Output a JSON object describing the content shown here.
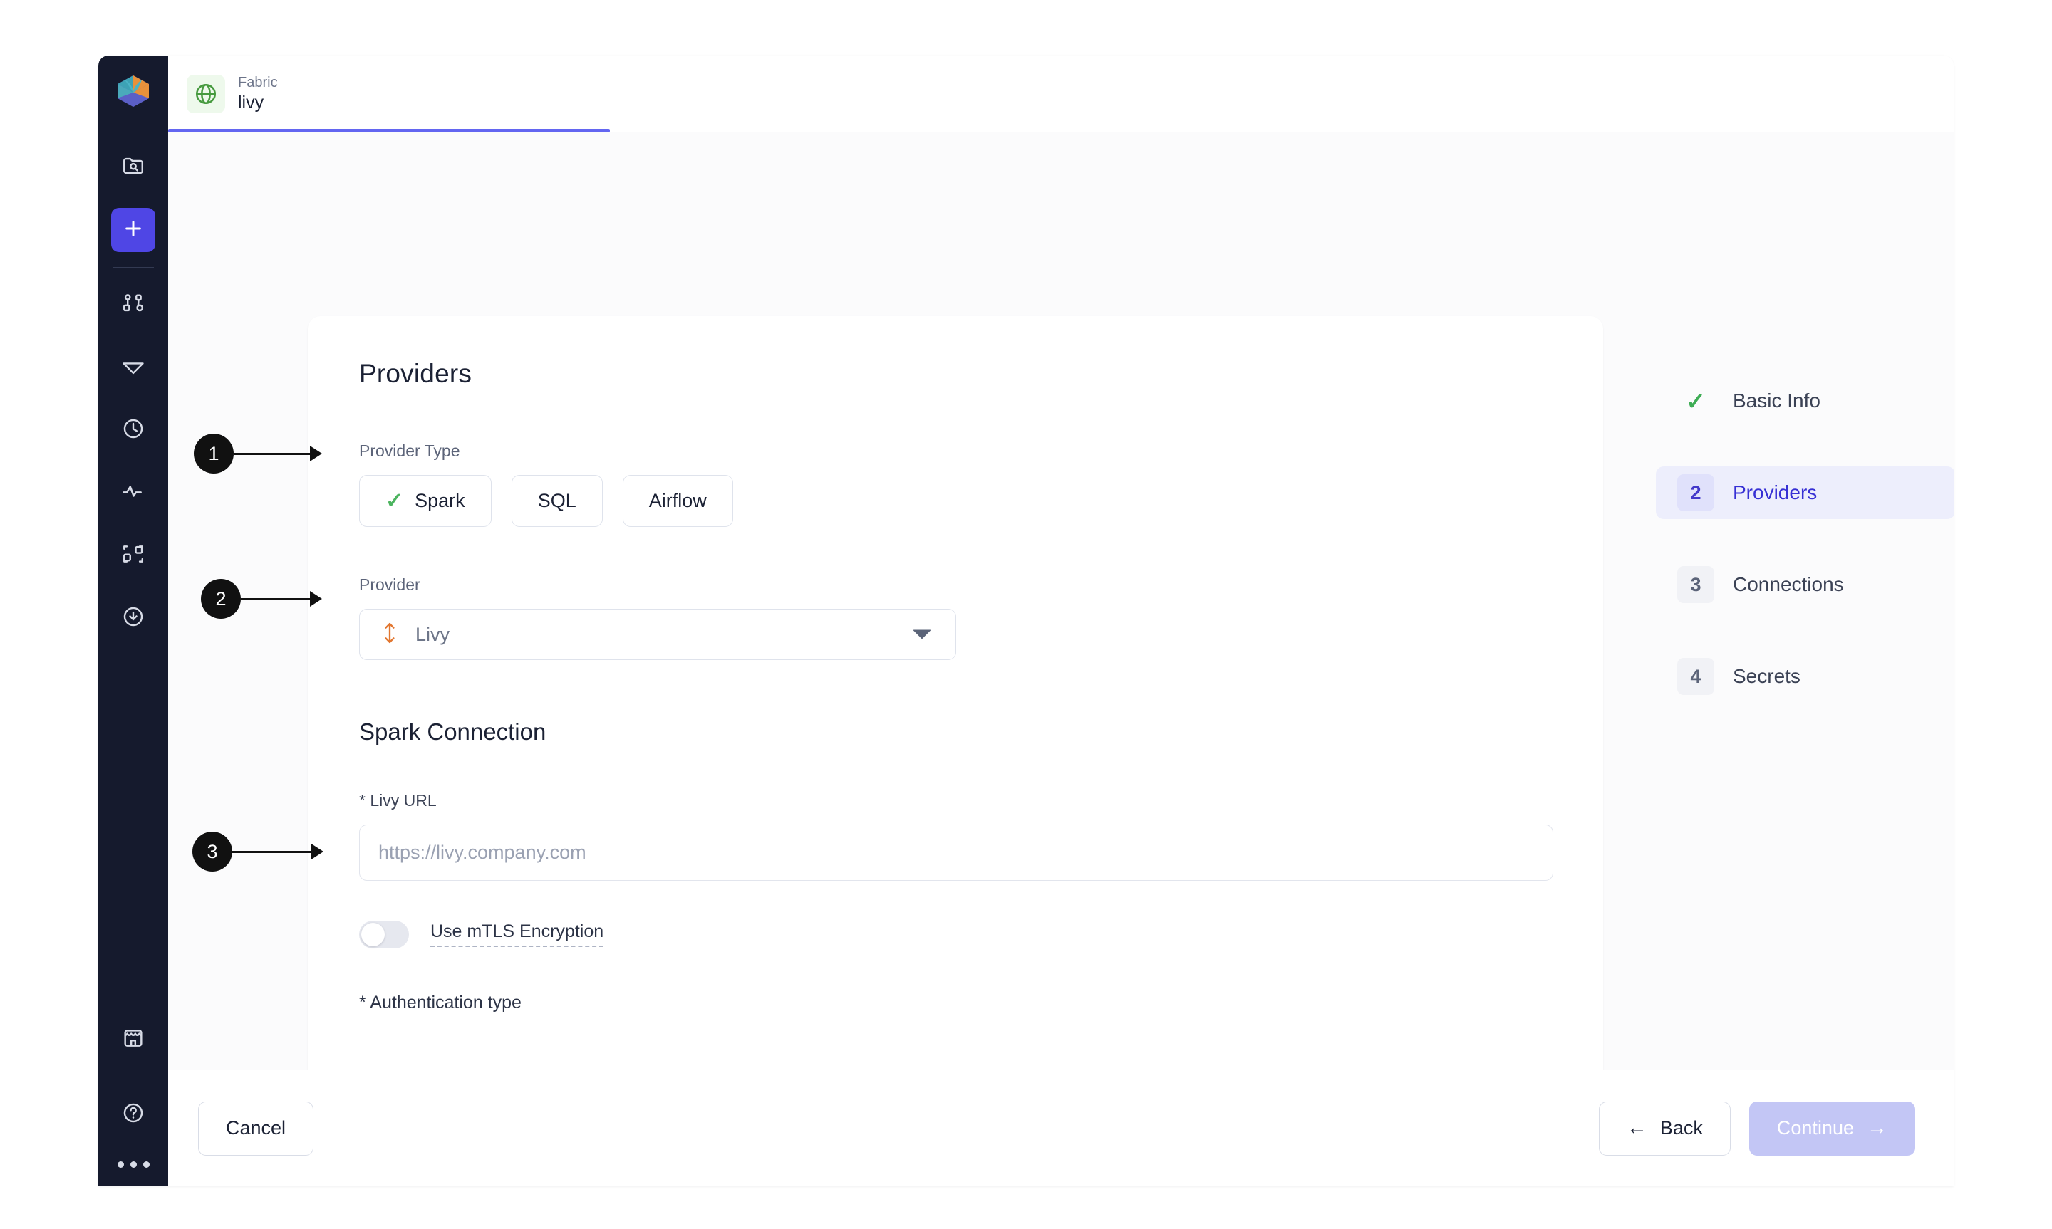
{
  "app": {
    "logo_icon": "hexagon-prism-logo",
    "rail_items": [
      {
        "name": "folder-search-icon",
        "active": false
      },
      {
        "name": "plus-icon",
        "active": true
      },
      {
        "name": "pipeline-graph-icon",
        "active": false
      },
      {
        "name": "gem-icon",
        "active": false
      },
      {
        "name": "clock-icon",
        "active": false
      },
      {
        "name": "activity-pulse-icon",
        "active": false
      },
      {
        "name": "connected-nodes-icon",
        "active": false
      },
      {
        "name": "download-circle-icon",
        "active": false
      },
      {
        "name": "marketplace-store-icon",
        "active": false
      },
      {
        "name": "help-circle-icon",
        "active": false
      }
    ],
    "overflow_menu": "more-dots"
  },
  "tab": {
    "icon": "globe-icon",
    "kicker": "Fabric",
    "title": "livy",
    "accent_color": "#6366f1"
  },
  "form": {
    "heading": "Providers",
    "provider_type": {
      "label": "Provider Type",
      "options": [
        {
          "label": "Spark",
          "selected": true
        },
        {
          "label": "SQL",
          "selected": false
        },
        {
          "label": "Airflow",
          "selected": false
        }
      ]
    },
    "provider": {
      "label": "Provider",
      "icon": "livy-updown-arrow-icon",
      "value": "Livy",
      "caret": "chevron-down-icon"
    },
    "connection_heading": "Spark Connection",
    "livy_url": {
      "label": "* Livy URL",
      "placeholder": "https://livy.company.com",
      "value": ""
    },
    "mtls": {
      "label": "Use mTLS Encryption",
      "enabled": false
    },
    "auth_type_label": "* Authentication type"
  },
  "steps": [
    {
      "marker": "check",
      "label": "Basic Info",
      "state": "complete"
    },
    {
      "marker": "2",
      "label": "Providers",
      "state": "active"
    },
    {
      "marker": "3",
      "label": "Connections",
      "state": "pending"
    },
    {
      "marker": "4",
      "label": "Secrets",
      "state": "pending"
    }
  ],
  "footer": {
    "cancel": "Cancel",
    "back": "Back",
    "back_arrow": "←",
    "continue": "Continue",
    "continue_arrow": "→"
  },
  "annotations": [
    {
      "number": "1",
      "target": "spark-chip"
    },
    {
      "number": "2",
      "target": "provider-select"
    },
    {
      "number": "3",
      "target": "livy-url-input"
    }
  ]
}
